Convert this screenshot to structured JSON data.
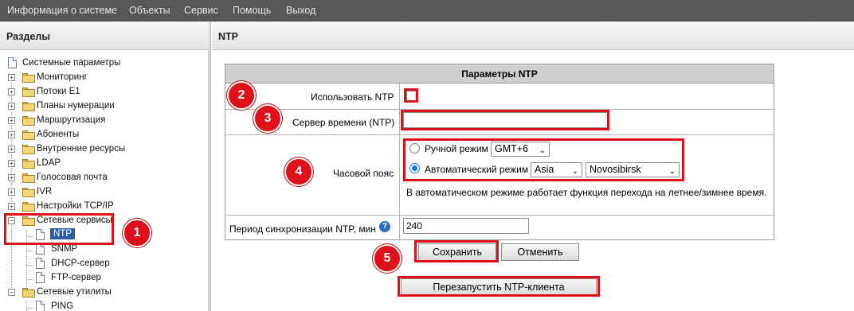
{
  "menu": [
    "Информация о системе",
    "Объекты",
    "Сервис",
    "Помощь",
    "Выход"
  ],
  "left_panel": {
    "title": "Разделы",
    "tree": [
      {
        "label": "Системные параметры"
      },
      {
        "label": "Мониторинг"
      },
      {
        "label": "Потоки E1"
      },
      {
        "label": "Планы нумерации"
      },
      {
        "label": "Маршрутизация"
      },
      {
        "label": "Абоненты"
      },
      {
        "label": "Внутренние ресурсы"
      },
      {
        "label": "LDAP"
      },
      {
        "label": "Голосовая почта"
      },
      {
        "label": "IVR"
      },
      {
        "label": "Настройки TCP/IP"
      },
      {
        "label": "Сетевые сервисы"
      },
      {
        "label": "NTP"
      },
      {
        "label": "SNMP"
      },
      {
        "label": "DHCP-сервер"
      },
      {
        "label": "FTP-сервер"
      },
      {
        "label": "Сетевые утилиты"
      },
      {
        "label": "PING"
      }
    ],
    "expander_plus": "+",
    "expander_minus": "−"
  },
  "right_panel": {
    "title": "NTP",
    "table_title": "Параметры NTP",
    "use_ntp_label": "Использовать NTP",
    "server_label": "Сервер времени (NTP)",
    "server_value": "",
    "timezone_label": "Часовой пояс",
    "manual_mode_label": "Ручной режим",
    "manual_tz": "GMT+6",
    "auto_mode_label": "Автоматический режим",
    "region": "Asia",
    "city": "Novosibirsk",
    "dst_note": "В автоматическом режиме работает функция перехода на летнее/зимнее время.",
    "period_label": "Период синхронизации NTP, мин",
    "period_value": "240",
    "help_glyph": "?",
    "save_label": "Сохранить",
    "cancel_label": "Отменить",
    "restart_label": "Перезапустить NTP-клиента",
    "dropdown_arrow": "⌄"
  },
  "badges": [
    "1",
    "2",
    "3",
    "4",
    "5"
  ],
  "colors": {
    "highlight": "#e0101a",
    "selection": "#2c5ea8",
    "topbar": "#575757"
  }
}
